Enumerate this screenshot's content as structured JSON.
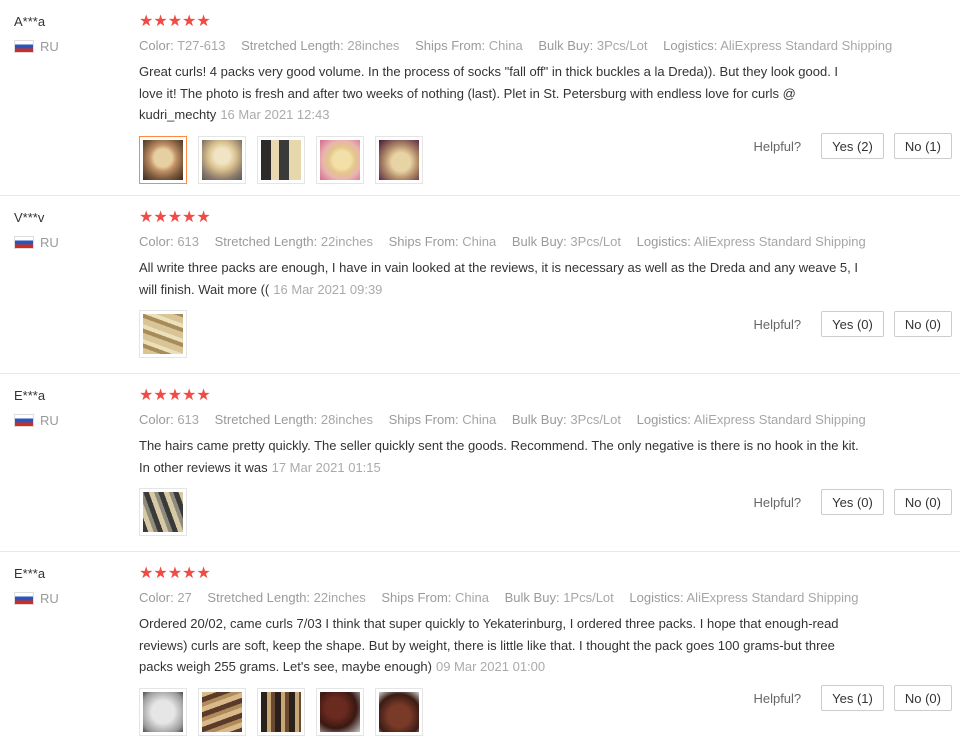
{
  "helpful_label": "Helpful?",
  "reviews": [
    {
      "user": "A***a",
      "country": "RU",
      "stars": "★★★★★",
      "attrs": {
        "color_k": "Color:",
        "color_v": "T27-613",
        "length_k": "Stretched Length:",
        "length_v": "28inches",
        "ships_k": "Ships From:",
        "ships_v": "China",
        "bulk_k": "Bulk Buy:",
        "bulk_v": "3Pcs/Lot",
        "log_k": "Logistics:",
        "log_v": "AliExpress Standard Shipping"
      },
      "text": "Great curls! 4 packs very good volume. In the process of socks \"fall off\" in thick buckles a la Dreda)). But they look good. I love it! The photo is fresh and after two weeks of nothing (last). Plet in St. Petersburg with endless love for curls @ kudri_mechty",
      "date": "16 Mar 2021 12:43",
      "yes": "Yes (2)",
      "no": "No (1)"
    },
    {
      "user": "V***v",
      "country": "RU",
      "stars": "★★★★★",
      "attrs": {
        "color_k": "Color:",
        "color_v": "613",
        "length_k": "Stretched Length:",
        "length_v": "22inches",
        "ships_k": "Ships From:",
        "ships_v": "China",
        "bulk_k": "Bulk Buy:",
        "bulk_v": "3Pcs/Lot",
        "log_k": "Logistics:",
        "log_v": "AliExpress Standard Shipping"
      },
      "text": "All write three packs are enough, I have in vain looked at the reviews, it is necessary as well as the Dreda and any weave 5, I will finish. Wait more ((",
      "date": "16 Mar 2021 09:39",
      "yes": "Yes (0)",
      "no": "No (0)"
    },
    {
      "user": "E***a",
      "country": "RU",
      "stars": "★★★★★",
      "attrs": {
        "color_k": "Color:",
        "color_v": "613",
        "length_k": "Stretched Length:",
        "length_v": "28inches",
        "ships_k": "Ships From:",
        "ships_v": "China",
        "bulk_k": "Bulk Buy:",
        "bulk_v": "3Pcs/Lot",
        "log_k": "Logistics:",
        "log_v": "AliExpress Standard Shipping"
      },
      "text": "The hairs came pretty quickly. The seller quickly sent the goods. Recommend. The only negative is there is no hook in the kit. In other reviews it was",
      "date": "17 Mar 2021 01:15",
      "yes": "Yes (0)",
      "no": "No (0)"
    },
    {
      "user": "E***a",
      "country": "RU",
      "stars": "★★★★★",
      "attrs": {
        "color_k": "Color:",
        "color_v": "27",
        "length_k": "Stretched Length:",
        "length_v": "22inches",
        "ships_k": "Ships From:",
        "ships_v": "China",
        "bulk_k": "Bulk Buy:",
        "bulk_v": "1Pcs/Lot",
        "log_k": "Logistics:",
        "log_v": "AliExpress Standard Shipping"
      },
      "text": "Ordered 20/02, came curls 7/03 I think that super quickly to Yekaterinburg, I ordered three packs. I hope that enough-read reviews) curls are soft, keep the shape. But by weight, there is little like that. I thought the pack goes 100 grams-but three packs weigh 255 grams. Let's see, maybe enough)",
      "date": "09 Mar 2021 01:00",
      "yes": "Yes (1)",
      "no": "No (0)"
    }
  ]
}
